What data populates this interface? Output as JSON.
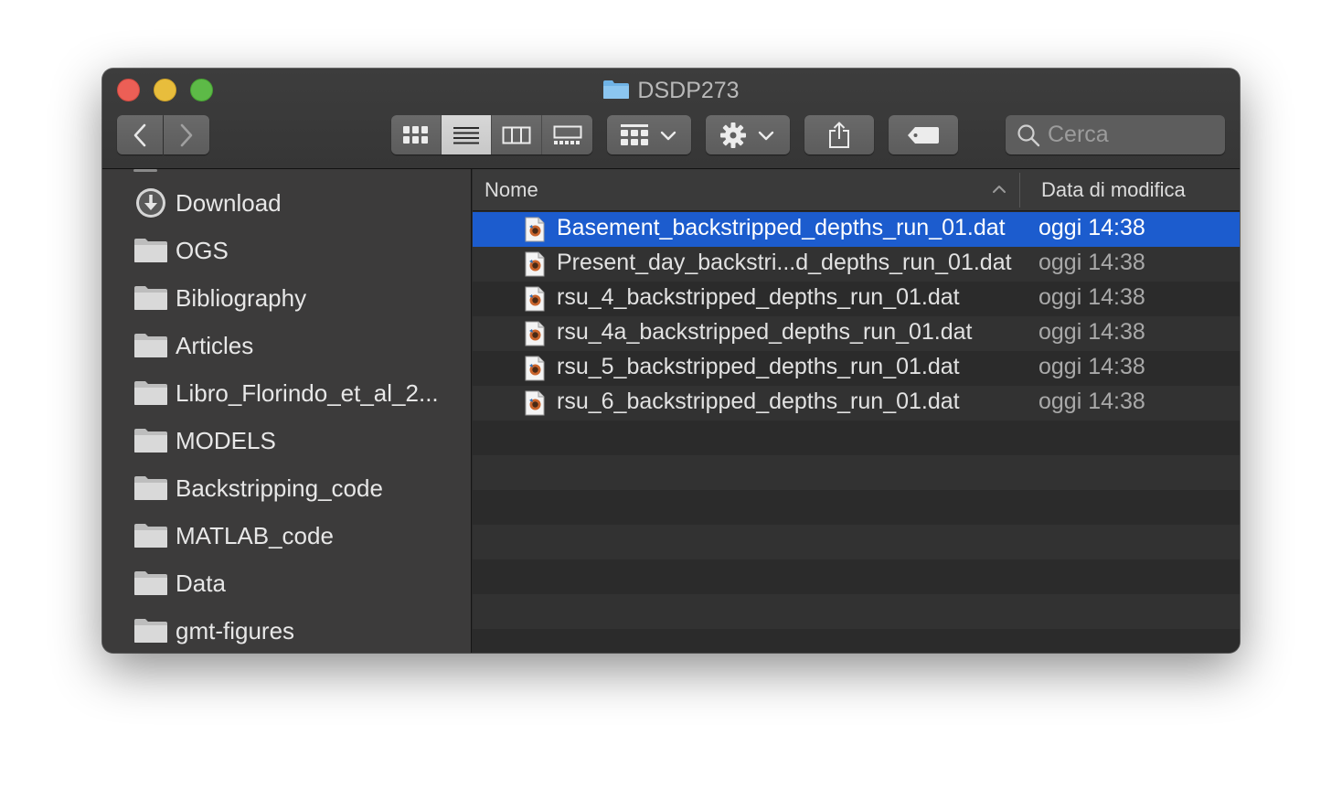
{
  "window": {
    "title": "DSDP273",
    "title_icon": "folder-icon"
  },
  "toolbar": {
    "back_icon": "chevron-left-icon",
    "forward_icon": "chevron-right-icon",
    "view_modes": [
      "icon-view",
      "list-view",
      "column-view",
      "gallery-view"
    ],
    "active_view": "list-view",
    "group_icon": "group-by-icon",
    "action_icon": "gear-icon",
    "share_icon": "share-icon",
    "tag_icon": "tag-icon",
    "search_placeholder": "Cerca"
  },
  "sidebar": {
    "items": [
      {
        "label": "Download",
        "icon": "download-icon"
      },
      {
        "label": "OGS",
        "icon": "folder-icon"
      },
      {
        "label": "Bibliography",
        "icon": "folder-icon"
      },
      {
        "label": "Articles",
        "icon": "folder-icon"
      },
      {
        "label": "Libro_Florindo_et_al_2...",
        "icon": "folder-icon"
      },
      {
        "label": "MODELS",
        "icon": "folder-icon"
      },
      {
        "label": "Backstripping_code",
        "icon": "folder-icon"
      },
      {
        "label": "MATLAB_code",
        "icon": "folder-icon"
      },
      {
        "label": "Data",
        "icon": "folder-icon"
      },
      {
        "label": "gmt-figures",
        "icon": "folder-icon"
      }
    ]
  },
  "file_list": {
    "columns": {
      "name": "Nome",
      "date": "Data di modifica"
    },
    "sort_indicator": "chevron-up-icon",
    "selected_index": 0,
    "files": [
      {
        "name": "Basement_backstripped_depths_run_01.dat",
        "date": "oggi 14:38",
        "icon": "dat-file-icon"
      },
      {
        "name": "Present_day_backstri...d_depths_run_01.dat",
        "date": "oggi 14:38",
        "icon": "dat-file-icon"
      },
      {
        "name": "rsu_4_backstripped_depths_run_01.dat",
        "date": "oggi 14:38",
        "icon": "dat-file-icon"
      },
      {
        "name": "rsu_4a_backstripped_depths_run_01.dat",
        "date": "oggi 14:38",
        "icon": "dat-file-icon"
      },
      {
        "name": "rsu_5_backstripped_depths_run_01.dat",
        "date": "oggi 14:38",
        "icon": "dat-file-icon"
      },
      {
        "name": "rsu_6_backstripped_depths_run_01.dat",
        "date": "oggi 14:38",
        "icon": "dat-file-icon"
      }
    ]
  },
  "colors": {
    "selection": "#1c5cce",
    "close": "#ec5f56",
    "minimize": "#e8bd3c",
    "maximize": "#5dba47",
    "folder_blue": "#6fb3e6"
  }
}
